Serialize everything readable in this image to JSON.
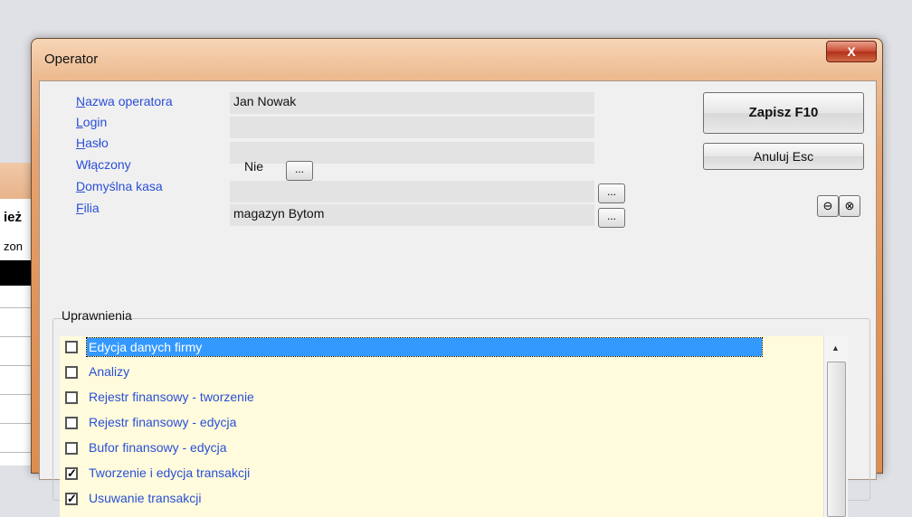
{
  "background": {
    "label1": "ież",
    "label2": "zon"
  },
  "dialog": {
    "title": "Operator",
    "close_glyph": "X",
    "fields": {
      "operator_name": {
        "label_first": "N",
        "label_rest": "azwa operatora",
        "value": "Jan Nowak"
      },
      "login": {
        "label_first": "L",
        "label_rest": "ogin",
        "value": ""
      },
      "password": {
        "label_first": "H",
        "label_rest": "asło",
        "value": ""
      },
      "enabled": {
        "label": "Włączony",
        "value": "Nie",
        "btn": "..."
      },
      "default_cash": {
        "label_first": "D",
        "label_rest": "omyślna kasa",
        "value": "",
        "btn": "..."
      },
      "branch": {
        "label_first": "F",
        "label_rest": "ilia",
        "value": "magazyn Bytom",
        "btn": "..."
      }
    },
    "buttons": {
      "save": "Zapisz F10",
      "cancel": "Anuluj Esc",
      "icon1": "⊖",
      "icon2": "⊗"
    },
    "permissions": {
      "title": "Uprawnienia",
      "items": [
        {
          "label": "Edycja danych firmy",
          "checked": false,
          "selected": true
        },
        {
          "label": "Analizy",
          "checked": false
        },
        {
          "label": "Rejestr finansowy - tworzenie",
          "checked": false
        },
        {
          "label": "Rejestr finansowy - edycja",
          "checked": false
        },
        {
          "label": "Bufor finansowy - edycja",
          "checked": false
        },
        {
          "label": "Tworzenie i edycja transakcji",
          "checked": true
        },
        {
          "label": "Usuwanie transakcji",
          "checked": true
        }
      ]
    }
  }
}
